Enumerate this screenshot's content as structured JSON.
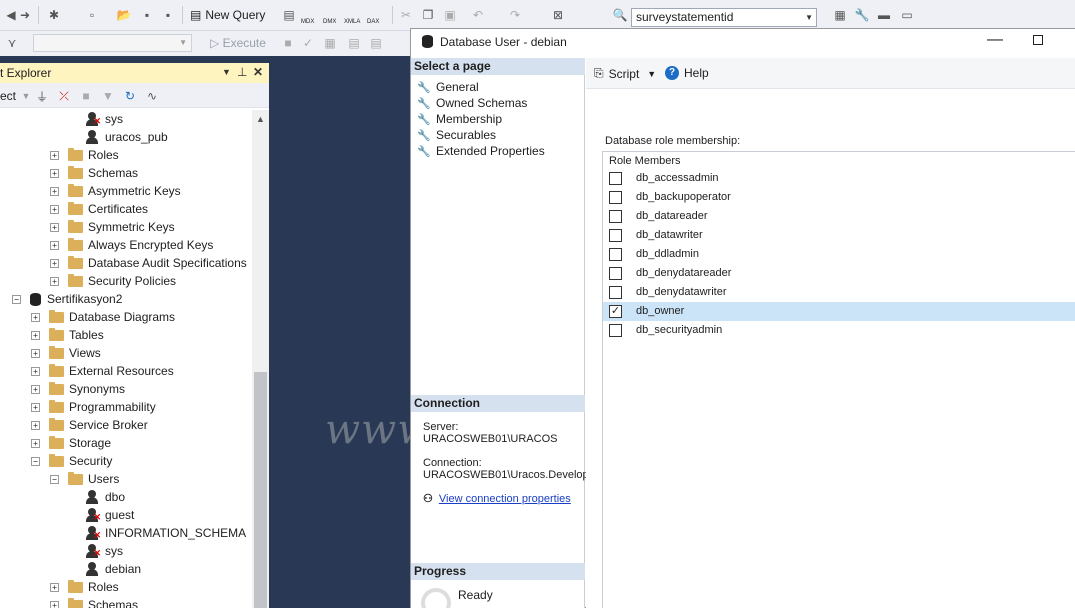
{
  "toolbar": {
    "new_query_label": "New Query",
    "mdx_label": "MDX",
    "dmx_label": "DMX",
    "xmla_label": "XMLA",
    "dax_label": "DAX",
    "database_value": "surveystatementid",
    "execute_label": "Execute"
  },
  "object_explorer": {
    "title": "t Explorer",
    "connect_label": "ect",
    "tree": [
      {
        "label": "sys",
        "kind": "user-x",
        "indent": 85,
        "expander": ""
      },
      {
        "label": "uracos_pub",
        "kind": "user",
        "indent": 85,
        "expander": ""
      },
      {
        "label": "Roles",
        "kind": "folder",
        "indent": 50,
        "expander": "+"
      },
      {
        "label": "Schemas",
        "kind": "folder",
        "indent": 50,
        "expander": "+"
      },
      {
        "label": "Asymmetric Keys",
        "kind": "folder",
        "indent": 50,
        "expander": "+"
      },
      {
        "label": "Certificates",
        "kind": "folder",
        "indent": 50,
        "expander": "+"
      },
      {
        "label": "Symmetric Keys",
        "kind": "folder",
        "indent": 50,
        "expander": "+"
      },
      {
        "label": "Always Encrypted Keys",
        "kind": "folder",
        "indent": 50,
        "expander": "+"
      },
      {
        "label": "Database Audit Specifications",
        "kind": "folder",
        "indent": 50,
        "expander": "+"
      },
      {
        "label": "Security Policies",
        "kind": "folder",
        "indent": 50,
        "expander": "+"
      },
      {
        "label": "Sertifikasyon2",
        "kind": "db",
        "indent": 12,
        "expander": "-"
      },
      {
        "label": "Database Diagrams",
        "kind": "folder",
        "indent": 31,
        "expander": "+"
      },
      {
        "label": "Tables",
        "kind": "folder",
        "indent": 31,
        "expander": "+"
      },
      {
        "label": "Views",
        "kind": "folder",
        "indent": 31,
        "expander": "+"
      },
      {
        "label": "External Resources",
        "kind": "folder",
        "indent": 31,
        "expander": "+"
      },
      {
        "label": "Synonyms",
        "kind": "folder",
        "indent": 31,
        "expander": "+"
      },
      {
        "label": "Programmability",
        "kind": "folder",
        "indent": 31,
        "expander": "+"
      },
      {
        "label": "Service Broker",
        "kind": "folder",
        "indent": 31,
        "expander": "+"
      },
      {
        "label": "Storage",
        "kind": "folder",
        "indent": 31,
        "expander": "+"
      },
      {
        "label": "Security",
        "kind": "folder",
        "indent": 31,
        "expander": "-"
      },
      {
        "label": "Users",
        "kind": "folder",
        "indent": 50,
        "expander": "-"
      },
      {
        "label": "dbo",
        "kind": "user",
        "indent": 85,
        "expander": ""
      },
      {
        "label": "guest",
        "kind": "user-x",
        "indent": 85,
        "expander": ""
      },
      {
        "label": "INFORMATION_SCHEMA",
        "kind": "user-x",
        "indent": 85,
        "expander": ""
      },
      {
        "label": "sys",
        "kind": "user-x",
        "indent": 85,
        "expander": ""
      },
      {
        "label": "debian",
        "kind": "user",
        "indent": 85,
        "expander": ""
      },
      {
        "label": "Roles",
        "kind": "folder",
        "indent": 50,
        "expander": "+"
      },
      {
        "label": "Schemas",
        "kind": "folder",
        "indent": 50,
        "expander": "+"
      }
    ]
  },
  "dialog": {
    "title": "Database User - debian",
    "select_page_header": "Select a page",
    "pages": [
      "General",
      "Owned Schemas",
      "Membership",
      "Securables",
      "Extended Properties"
    ],
    "script_label": "Script",
    "help_label": "Help",
    "membership_label": "Database role membership:",
    "role_members_header": "Role Members",
    "roles": [
      {
        "name": "db_accessadmin",
        "checked": false
      },
      {
        "name": "db_backupoperator",
        "checked": false
      },
      {
        "name": "db_datareader",
        "checked": false
      },
      {
        "name": "db_datawriter",
        "checked": false
      },
      {
        "name": "db_ddladmin",
        "checked": false
      },
      {
        "name": "db_denydatareader",
        "checked": false
      },
      {
        "name": "db_denydatawriter",
        "checked": false
      },
      {
        "name": "db_owner",
        "checked": true
      },
      {
        "name": "db_securityadmin",
        "checked": false
      }
    ],
    "connection_header": "Connection",
    "server_label": "Server:",
    "server_value": "URACOSWEB01\\URACOS",
    "connection_label": "Connection:",
    "connection_value": "URACOSWEB01\\Uracos.Develop",
    "view_connection_link": "View connection properties",
    "progress_header": "Progress",
    "progress_status": "Ready"
  },
  "watermark": "www.yutaldevs.com",
  "colors": {
    "tree_folder": "#dcb05a",
    "selected_row": "#cce4f7",
    "section_header": "#d6e1ef",
    "oe_title": "#fdf4bf",
    "desktop": "#293955"
  }
}
